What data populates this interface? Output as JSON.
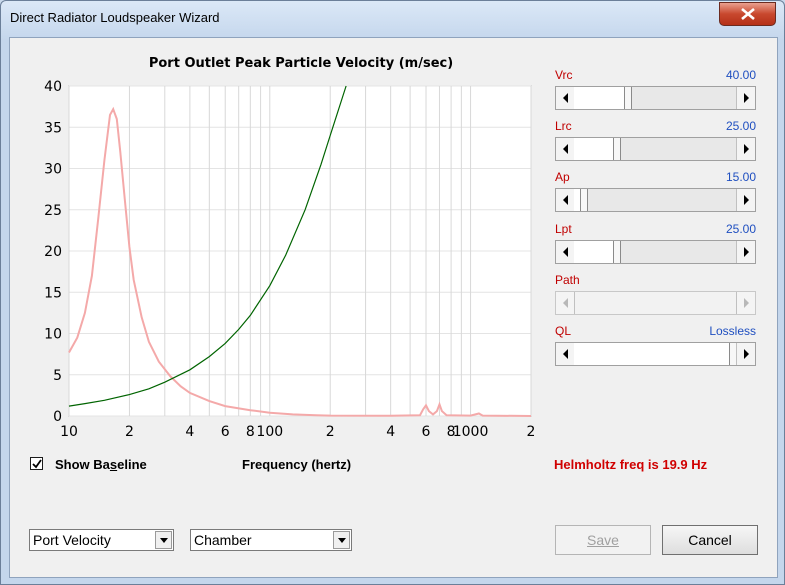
{
  "window": {
    "title": "Direct Radiator Loudspeaker Wizard"
  },
  "chart_data": {
    "type": "line",
    "title": "Port Outlet Peak Particle Velocity (m/sec)",
    "xlabel": "Frequency (hertz)",
    "ylabel": "",
    "x_scale": "log",
    "xlim": [
      10,
      2000
    ],
    "ylim": [
      0,
      40
    ],
    "y_ticks": [
      "0",
      "5",
      "10",
      "15",
      "20",
      "25",
      "30",
      "35",
      "40"
    ],
    "x_ticks": [
      {
        "value": 10,
        "label": "10"
      },
      {
        "value": 20,
        "label": "2"
      },
      {
        "value": 40,
        "label": "4"
      },
      {
        "value": 60,
        "label": "6"
      },
      {
        "value": 80,
        "label": "8"
      },
      {
        "value": 100,
        "label": "100"
      },
      {
        "value": 200,
        "label": "2"
      },
      {
        "value": 400,
        "label": "4"
      },
      {
        "value": 600,
        "label": "6"
      },
      {
        "value": 800,
        "label": "8"
      },
      {
        "value": 1000,
        "label": "1000"
      },
      {
        "value": 2000,
        "label": "2"
      }
    ],
    "grid": true,
    "series": [
      {
        "color": "#f4a9a9",
        "points": [
          [
            10,
            7.7
          ],
          [
            11,
            9.5
          ],
          [
            12,
            12.5
          ],
          [
            13,
            17
          ],
          [
            14,
            24
          ],
          [
            15,
            31
          ],
          [
            16,
            36.5
          ],
          [
            16.6,
            37.2
          ],
          [
            17.3,
            36
          ],
          [
            18,
            32
          ],
          [
            19,
            26
          ],
          [
            20,
            20.5
          ],
          [
            21,
            16.5
          ],
          [
            23,
            12
          ],
          [
            25,
            9
          ],
          [
            28,
            6.6
          ],
          [
            32,
            4.8
          ],
          [
            36,
            3.6
          ],
          [
            40,
            2.8
          ],
          [
            50,
            1.8
          ],
          [
            60,
            1.2
          ],
          [
            80,
            0.7
          ],
          [
            100,
            0.4
          ],
          [
            130,
            0.2
          ],
          [
            170,
            0.1
          ],
          [
            200,
            0.05
          ],
          [
            400,
            0.02
          ],
          [
            560,
            0.1
          ],
          [
            580,
            0.8
          ],
          [
            600,
            1.3
          ],
          [
            620,
            0.6
          ],
          [
            650,
            0.2
          ],
          [
            680,
            0.6
          ],
          [
            700,
            1.4
          ],
          [
            720,
            0.6
          ],
          [
            760,
            0.1
          ],
          [
            1000,
            0.05
          ],
          [
            1100,
            0.3
          ],
          [
            1150,
            0.05
          ],
          [
            2000,
            0
          ]
        ]
      },
      {
        "color": "#006400",
        "points": [
          [
            10,
            1.2
          ],
          [
            12,
            1.5
          ],
          [
            15,
            1.9
          ],
          [
            20,
            2.6
          ],
          [
            25,
            3.3
          ],
          [
            30,
            4.1
          ],
          [
            40,
            5.6
          ],
          [
            50,
            7.2
          ],
          [
            60,
            8.8
          ],
          [
            70,
            10.5
          ],
          [
            80,
            12.2
          ],
          [
            100,
            15.8
          ],
          [
            120,
            19.5
          ],
          [
            150,
            25
          ],
          [
            180,
            30.5
          ],
          [
            200,
            34
          ],
          [
            230,
            38.6
          ],
          [
            240,
            40
          ]
        ]
      }
    ]
  },
  "params": [
    {
      "label": "Vrc",
      "value": "40.00",
      "position": 0.32
    },
    {
      "label": "Lrc",
      "value": "25.00",
      "position": 0.25
    },
    {
      "label": "Ap",
      "value": "15.00",
      "position": 0.04
    },
    {
      "label": "Lpt",
      "value": "25.00",
      "position": 0.25
    },
    {
      "label": "Path",
      "value": "",
      "position": 0.0,
      "disabled": true
    },
    {
      "label": "QL",
      "value": "Lossless",
      "position": 1.0
    }
  ],
  "baseline": {
    "label": "Show Baseline",
    "mnemonic_index": 7,
    "checked": true
  },
  "status": {
    "helmholtz": "Helmholtz freq is 19.9 Hz"
  },
  "dropdowns": {
    "plot_type": "Port Velocity",
    "location": "Chamber"
  },
  "buttons": {
    "save": "Save",
    "cancel": "Cancel"
  },
  "colors": {
    "label_red": "#c00000",
    "value_blue": "#1f4fc0",
    "highlight_red": "#d00000"
  }
}
